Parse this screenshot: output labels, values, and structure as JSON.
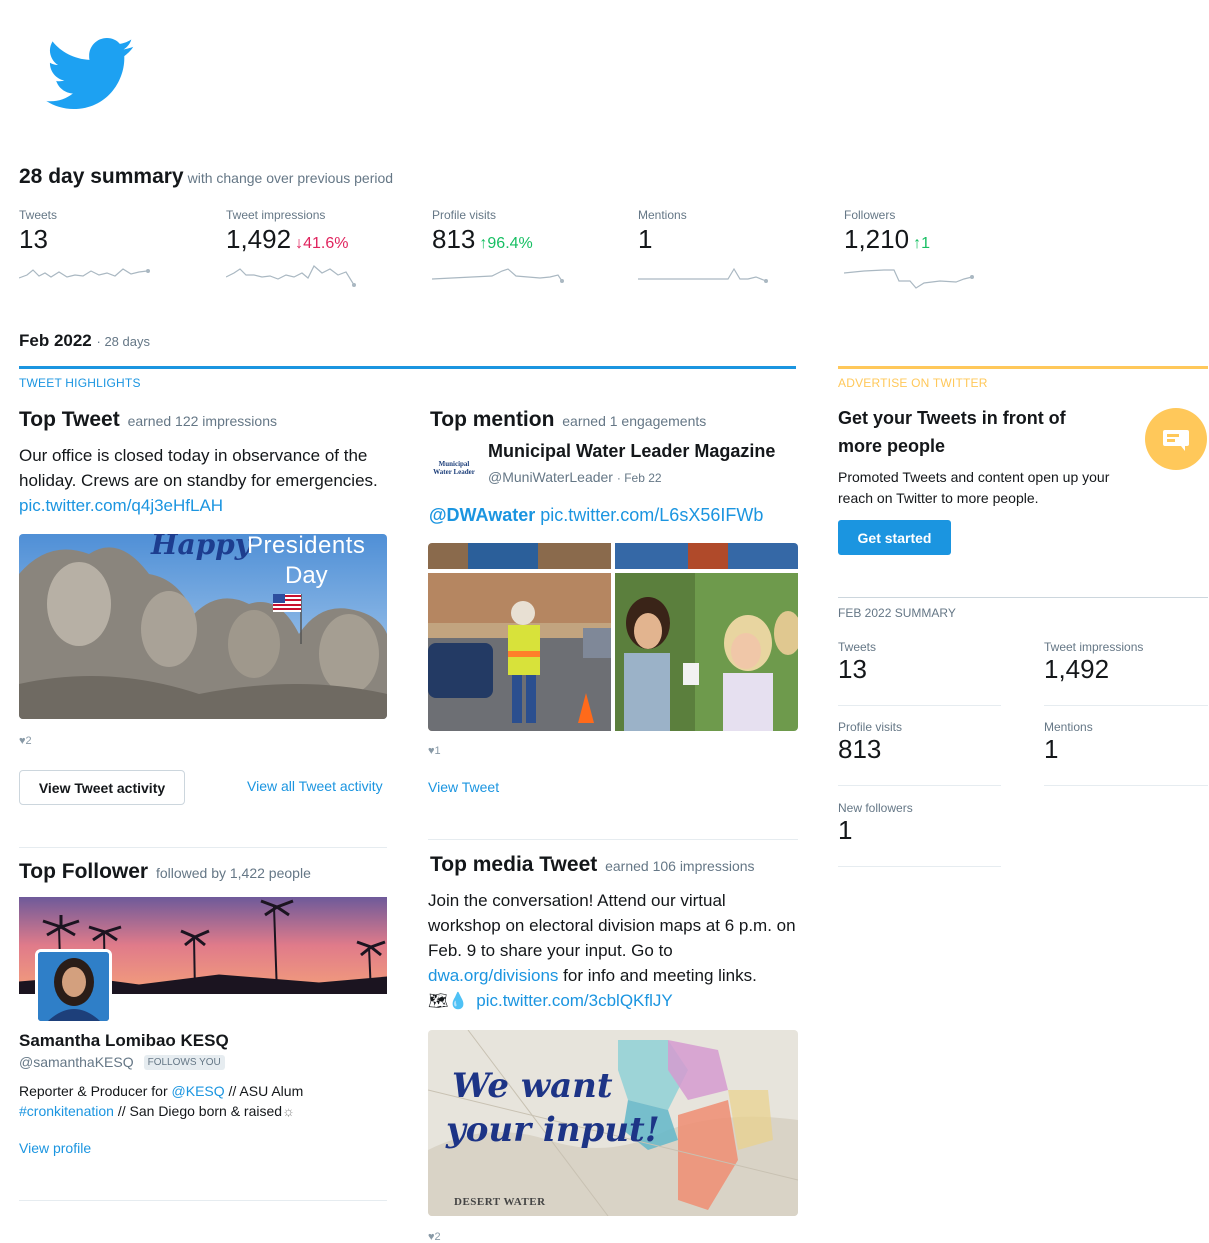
{
  "brand": {
    "logo_icon": "twitter-bird-icon",
    "color": "#1da1f2"
  },
  "summary": {
    "title": "28 day summary",
    "subtitle": "with change over previous period",
    "stats": [
      {
        "label": "Tweets",
        "value": "13",
        "change": ""
      },
      {
        "label": "Tweet impressions",
        "value": "1,492",
        "change": "41.6%",
        "direction": "down",
        "arrow": "↓"
      },
      {
        "label": "Profile visits",
        "value": "813",
        "change": "96.4%",
        "direction": "up",
        "arrow": "↑"
      },
      {
        "label": "Mentions",
        "value": "1",
        "change": ""
      },
      {
        "label": "Followers",
        "value": "1,210",
        "change": "1",
        "direction": "up",
        "arrow": "↑"
      }
    ]
  },
  "period": {
    "month": "Feb 2022",
    "days": "· 28 days"
  },
  "highlights": {
    "section_label": "TWEET HIGHLIGHTS",
    "top_tweet": {
      "title": "Top Tweet",
      "sub": "earned 122 impressions",
      "text": "Our office is closed today in observance of the holiday. Crews are on standby for emergencies.",
      "link": "pic.twitter.com/q4j3eHfLAH",
      "image_text_1": "Happy",
      "image_text_2": "Presidents",
      "image_text_3": "Day",
      "likes": "2",
      "view_activity_label": "View Tweet activity",
      "view_all_label": "View all Tweet activity"
    },
    "top_mention": {
      "title": "Top mention",
      "sub": "earned 1 engagements",
      "avatar_text": "Municipal Water Leader",
      "name": "Municipal Water Leader Magazine",
      "handle": "@MuniWaterLeader",
      "date": "· Feb 22",
      "mention": "@DWAwater",
      "link": "pic.twitter.com/L6sX56IFWb",
      "likes": "1",
      "view_tweet_label": "View Tweet"
    },
    "top_follower": {
      "title": "Top Follower",
      "sub": "followed by 1,422 people",
      "name": "Samantha Lomibao KESQ",
      "handle": "@samanthaKESQ",
      "badge": "FOLLOWS YOU",
      "bio_1": "Reporter & Producer for",
      "bio_mention": "@KESQ",
      "bio_2": "// ASU Alum",
      "bio_hashtag": "#cronkitenation",
      "bio_3": "// San Diego born & raised",
      "view_profile_label": "View profile"
    },
    "top_media": {
      "title": "Top media Tweet",
      "sub": "earned 106 impressions",
      "text_1": "Join the conversation! Attend our virtual workshop on electoral division maps at 6 p.m. on Feb. 9 to share your input. Go to",
      "link_1": "dwa.org/divisions",
      "text_2": "for info and meeting links.",
      "link_2": "pic.twitter.com/3cblQKflJY",
      "image_text_1": "We want",
      "image_text_2": "your input!",
      "image_brand": "DESERT WATER",
      "likes": "2"
    }
  },
  "advertise": {
    "section_label": "ADVERTISE ON TWITTER",
    "heading": "Get your Tweets in front of more people",
    "text": "Promoted Tweets and content open up your reach on Twitter to more people.",
    "button": "Get started",
    "accent": "#ffc85a"
  },
  "feb_summary": {
    "label": "FEB 2022 SUMMARY",
    "items": [
      {
        "label": "Tweets",
        "value": "13"
      },
      {
        "label": "Tweet impressions",
        "value": "1,492"
      },
      {
        "label": "Profile visits",
        "value": "813"
      },
      {
        "label": "Mentions",
        "value": "1"
      },
      {
        "label": "New followers",
        "value": "1"
      }
    ]
  }
}
